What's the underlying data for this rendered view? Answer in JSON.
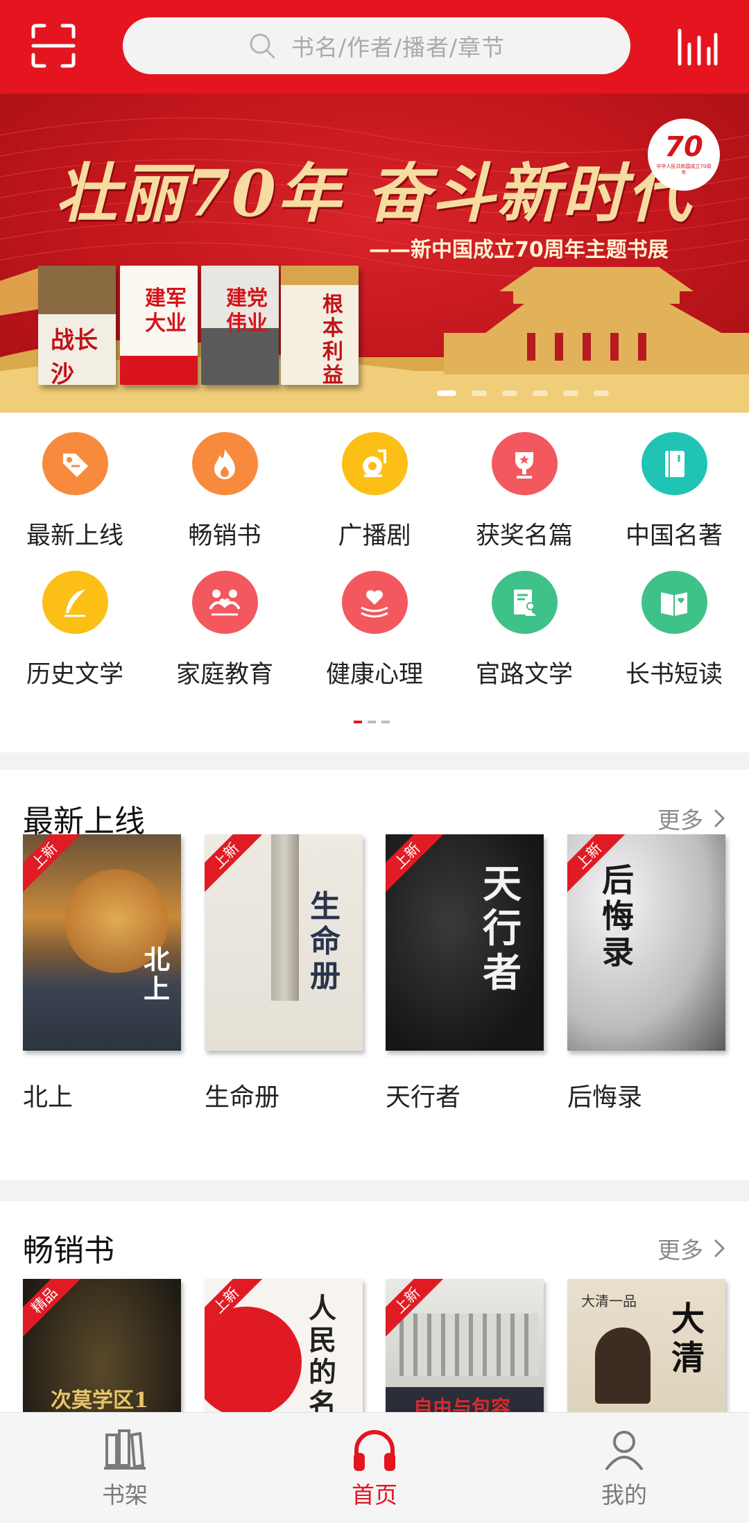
{
  "header": {
    "search_placeholder": "书名/作者/播者/章节",
    "scan_icon": "scan-icon",
    "rank_icon": "ranking-icon"
  },
  "banner": {
    "title": "壮丽70年 奋斗新时代",
    "subtitle": "——新中国成立70周年主题书展",
    "badge_number": "70",
    "badge_text": "中华人民共和国成立70周年",
    "books": [
      "战长沙",
      "建军大业",
      "建党伟业",
      "根本利益"
    ],
    "slide_count": 6,
    "active_slide": 0
  },
  "categories": [
    {
      "label": "最新上线",
      "icon": "new-tag-icon",
      "color": "#f78a3c"
    },
    {
      "label": "畅销书",
      "icon": "flame-icon",
      "color": "#f78a3c"
    },
    {
      "label": "广播剧",
      "icon": "radio-drama-icon",
      "color": "#fbbf16"
    },
    {
      "label": "获奖名篇",
      "icon": "trophy-icon",
      "color": "#f2585e"
    },
    {
      "label": "中国名著",
      "icon": "notebook-icon",
      "color": "#1fc4b5"
    },
    {
      "label": "历史文学",
      "icon": "quill-icon",
      "color": "#fbbf16"
    },
    {
      "label": "家庭教育",
      "icon": "family-icon",
      "color": "#f2585e"
    },
    {
      "label": "健康心理",
      "icon": "heart-hands-icon",
      "color": "#f2585e"
    },
    {
      "label": "官路文学",
      "icon": "document-person-icon",
      "color": "#3fc18a"
    },
    {
      "label": "长书短读",
      "icon": "open-book-icon",
      "color": "#3fc18a"
    }
  ],
  "sections": {
    "latest": {
      "title": "最新上线",
      "more": "更多",
      "books": [
        {
          "name": "北上",
          "tag": "上新",
          "cover_text": "北上"
        },
        {
          "name": "生命册",
          "tag": "上新",
          "cover_text": "生命册"
        },
        {
          "name": "天行者",
          "tag": "上新",
          "cover_text": "天行者"
        },
        {
          "name": "后悔录",
          "tag": "上新",
          "cover_text": "后悔录"
        }
      ]
    },
    "bestseller": {
      "title": "畅销书",
      "more": "更多",
      "books": [
        {
          "tag": "精品",
          "cover_text": "次莫学区1"
        },
        {
          "tag": "上新",
          "cover_text": "人民的名义"
        },
        {
          "tag": "上新",
          "cover_text": "自由与包容"
        },
        {
          "tag": "",
          "cover_text": "大清一品"
        }
      ]
    }
  },
  "tabbar": [
    {
      "label": "书架",
      "icon": "bookshelf-icon",
      "active": false
    },
    {
      "label": "首页",
      "icon": "headphones-icon",
      "active": true
    },
    {
      "label": "我的",
      "icon": "person-icon",
      "active": false
    }
  ],
  "colors": {
    "brand": "#e4151f",
    "gray_text": "#8a8a8a"
  }
}
